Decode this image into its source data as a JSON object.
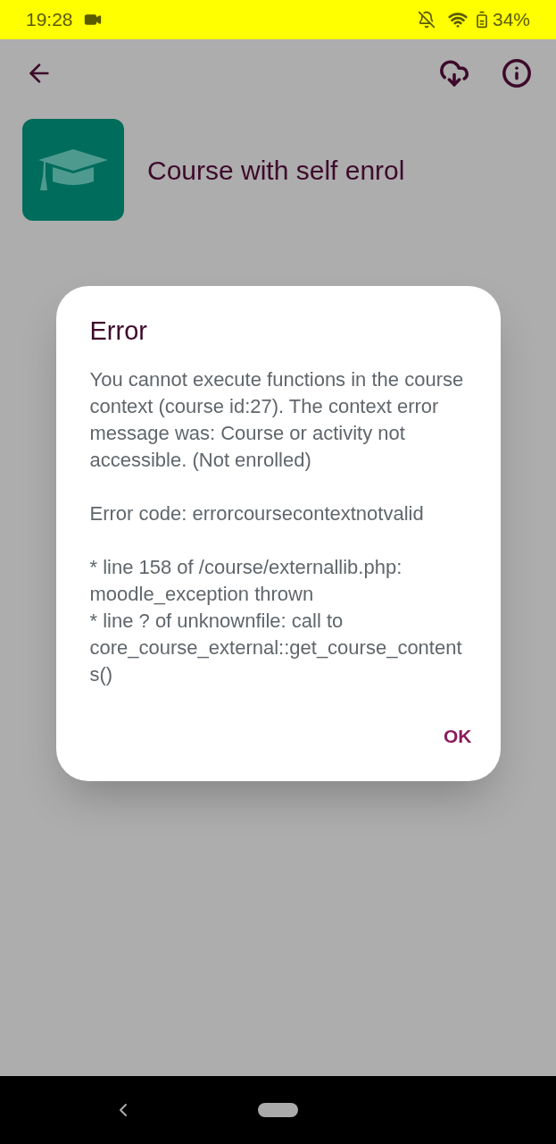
{
  "status_bar": {
    "time": "19:28",
    "battery": "34%"
  },
  "course": {
    "title": "Course with self enrol"
  },
  "dialog": {
    "title": "Error",
    "paragraphs": [
      [
        "You cannot execute functions in the course context (course id:27). The context error message was: Course or activity not accessible. (Not enrolled)"
      ],
      [
        "Error code: errorcoursecontextnotvalid"
      ],
      [
        "* line 158 of /course/externallib.php: moodle_exception thrown",
        "* line ? of unknownfile: call to core_course_external::get_course_contents()"
      ]
    ],
    "buttons": [
      "OK"
    ]
  }
}
